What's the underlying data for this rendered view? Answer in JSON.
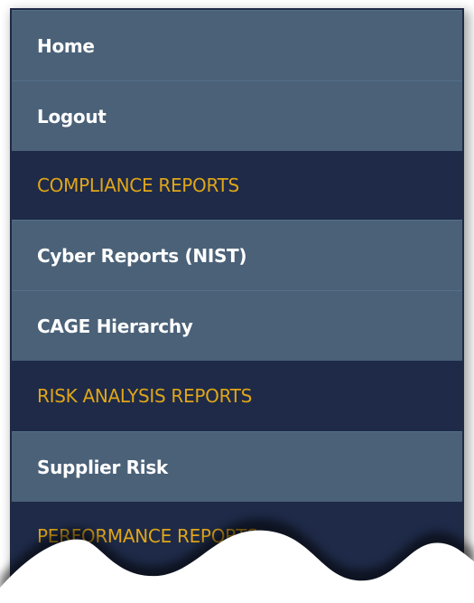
{
  "menu": {
    "items": [
      {
        "label": "Home",
        "kind": "item"
      },
      {
        "label": "Logout",
        "kind": "item"
      },
      {
        "label": "COMPLIANCE REPORTS",
        "kind": "header"
      },
      {
        "label": "Cyber Reports (NIST)",
        "kind": "item"
      },
      {
        "label": "CAGE Hierarchy",
        "kind": "item"
      },
      {
        "label": "RISK ANALYSIS REPORTS",
        "kind": "header"
      },
      {
        "label": "Supplier Risk",
        "kind": "item"
      },
      {
        "label": "PERFORMANCE REPORTS",
        "kind": "header"
      }
    ]
  },
  "colors": {
    "item_bg": "#4a6178",
    "header_bg": "#1e2a48",
    "header_text": "#e0a618",
    "item_text": "#ffffff"
  }
}
